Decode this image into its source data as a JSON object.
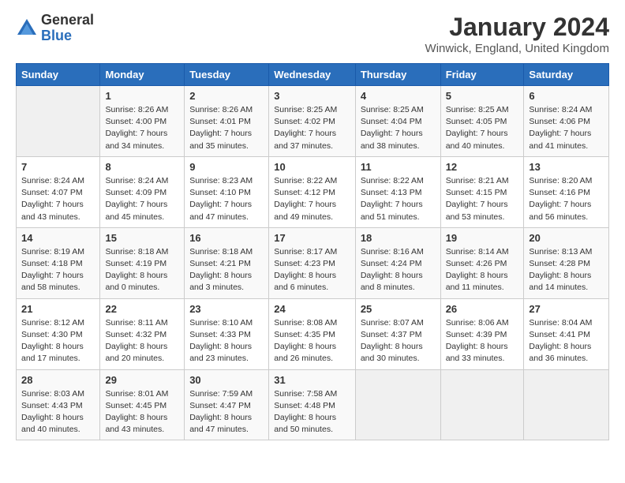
{
  "logo": {
    "general": "General",
    "blue": "Blue"
  },
  "title": "January 2024",
  "location": "Winwick, England, United Kingdom",
  "weekdays": [
    "Sunday",
    "Monday",
    "Tuesday",
    "Wednesday",
    "Thursday",
    "Friday",
    "Saturday"
  ],
  "weeks": [
    [
      {
        "day": "",
        "info": ""
      },
      {
        "day": "1",
        "info": "Sunrise: 8:26 AM\nSunset: 4:00 PM\nDaylight: 7 hours\nand 34 minutes."
      },
      {
        "day": "2",
        "info": "Sunrise: 8:26 AM\nSunset: 4:01 PM\nDaylight: 7 hours\nand 35 minutes."
      },
      {
        "day": "3",
        "info": "Sunrise: 8:25 AM\nSunset: 4:02 PM\nDaylight: 7 hours\nand 37 minutes."
      },
      {
        "day": "4",
        "info": "Sunrise: 8:25 AM\nSunset: 4:04 PM\nDaylight: 7 hours\nand 38 minutes."
      },
      {
        "day": "5",
        "info": "Sunrise: 8:25 AM\nSunset: 4:05 PM\nDaylight: 7 hours\nand 40 minutes."
      },
      {
        "day": "6",
        "info": "Sunrise: 8:24 AM\nSunset: 4:06 PM\nDaylight: 7 hours\nand 41 minutes."
      }
    ],
    [
      {
        "day": "7",
        "info": "Sunrise: 8:24 AM\nSunset: 4:07 PM\nDaylight: 7 hours\nand 43 minutes."
      },
      {
        "day": "8",
        "info": "Sunrise: 8:24 AM\nSunset: 4:09 PM\nDaylight: 7 hours\nand 45 minutes."
      },
      {
        "day": "9",
        "info": "Sunrise: 8:23 AM\nSunset: 4:10 PM\nDaylight: 7 hours\nand 47 minutes."
      },
      {
        "day": "10",
        "info": "Sunrise: 8:22 AM\nSunset: 4:12 PM\nDaylight: 7 hours\nand 49 minutes."
      },
      {
        "day": "11",
        "info": "Sunrise: 8:22 AM\nSunset: 4:13 PM\nDaylight: 7 hours\nand 51 minutes."
      },
      {
        "day": "12",
        "info": "Sunrise: 8:21 AM\nSunset: 4:15 PM\nDaylight: 7 hours\nand 53 minutes."
      },
      {
        "day": "13",
        "info": "Sunrise: 8:20 AM\nSunset: 4:16 PM\nDaylight: 7 hours\nand 56 minutes."
      }
    ],
    [
      {
        "day": "14",
        "info": "Sunrise: 8:19 AM\nSunset: 4:18 PM\nDaylight: 7 hours\nand 58 minutes."
      },
      {
        "day": "15",
        "info": "Sunrise: 8:18 AM\nSunset: 4:19 PM\nDaylight: 8 hours\nand 0 minutes."
      },
      {
        "day": "16",
        "info": "Sunrise: 8:18 AM\nSunset: 4:21 PM\nDaylight: 8 hours\nand 3 minutes."
      },
      {
        "day": "17",
        "info": "Sunrise: 8:17 AM\nSunset: 4:23 PM\nDaylight: 8 hours\nand 6 minutes."
      },
      {
        "day": "18",
        "info": "Sunrise: 8:16 AM\nSunset: 4:24 PM\nDaylight: 8 hours\nand 8 minutes."
      },
      {
        "day": "19",
        "info": "Sunrise: 8:14 AM\nSunset: 4:26 PM\nDaylight: 8 hours\nand 11 minutes."
      },
      {
        "day": "20",
        "info": "Sunrise: 8:13 AM\nSunset: 4:28 PM\nDaylight: 8 hours\nand 14 minutes."
      }
    ],
    [
      {
        "day": "21",
        "info": "Sunrise: 8:12 AM\nSunset: 4:30 PM\nDaylight: 8 hours\nand 17 minutes."
      },
      {
        "day": "22",
        "info": "Sunrise: 8:11 AM\nSunset: 4:32 PM\nDaylight: 8 hours\nand 20 minutes."
      },
      {
        "day": "23",
        "info": "Sunrise: 8:10 AM\nSunset: 4:33 PM\nDaylight: 8 hours\nand 23 minutes."
      },
      {
        "day": "24",
        "info": "Sunrise: 8:08 AM\nSunset: 4:35 PM\nDaylight: 8 hours\nand 26 minutes."
      },
      {
        "day": "25",
        "info": "Sunrise: 8:07 AM\nSunset: 4:37 PM\nDaylight: 8 hours\nand 30 minutes."
      },
      {
        "day": "26",
        "info": "Sunrise: 8:06 AM\nSunset: 4:39 PM\nDaylight: 8 hours\nand 33 minutes."
      },
      {
        "day": "27",
        "info": "Sunrise: 8:04 AM\nSunset: 4:41 PM\nDaylight: 8 hours\nand 36 minutes."
      }
    ],
    [
      {
        "day": "28",
        "info": "Sunrise: 8:03 AM\nSunset: 4:43 PM\nDaylight: 8 hours\nand 40 minutes."
      },
      {
        "day": "29",
        "info": "Sunrise: 8:01 AM\nSunset: 4:45 PM\nDaylight: 8 hours\nand 43 minutes."
      },
      {
        "day": "30",
        "info": "Sunrise: 7:59 AM\nSunset: 4:47 PM\nDaylight: 8 hours\nand 47 minutes."
      },
      {
        "day": "31",
        "info": "Sunrise: 7:58 AM\nSunset: 4:48 PM\nDaylight: 8 hours\nand 50 minutes."
      },
      {
        "day": "",
        "info": ""
      },
      {
        "day": "",
        "info": ""
      },
      {
        "day": "",
        "info": ""
      }
    ]
  ]
}
